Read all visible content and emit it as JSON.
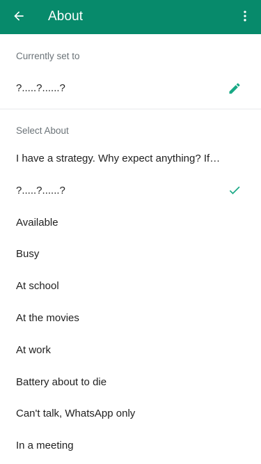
{
  "header": {
    "title": "About",
    "back_icon": "arrow-left-icon",
    "menu_icon": "more-vertical-icon",
    "color": "#078a6b"
  },
  "current": {
    "label": "Currently set to",
    "value": "?.....?......?",
    "edit_icon": "pencil-icon"
  },
  "select": {
    "label": "Select About",
    "items": [
      {
        "text": "I have a strategy. Why expect anything? If…",
        "selected": false
      },
      {
        "text": "?.....?......?",
        "selected": true
      },
      {
        "text": "Available",
        "selected": false
      },
      {
        "text": "Busy",
        "selected": false
      },
      {
        "text": "At school",
        "selected": false
      },
      {
        "text": "At the movies",
        "selected": false
      },
      {
        "text": "At work",
        "selected": false
      },
      {
        "text": "Battery about to die",
        "selected": false
      },
      {
        "text": "Can't talk, WhatsApp only",
        "selected": false
      },
      {
        "text": "In a meeting",
        "selected": false
      }
    ]
  },
  "colors": {
    "accent": "#17a884"
  }
}
